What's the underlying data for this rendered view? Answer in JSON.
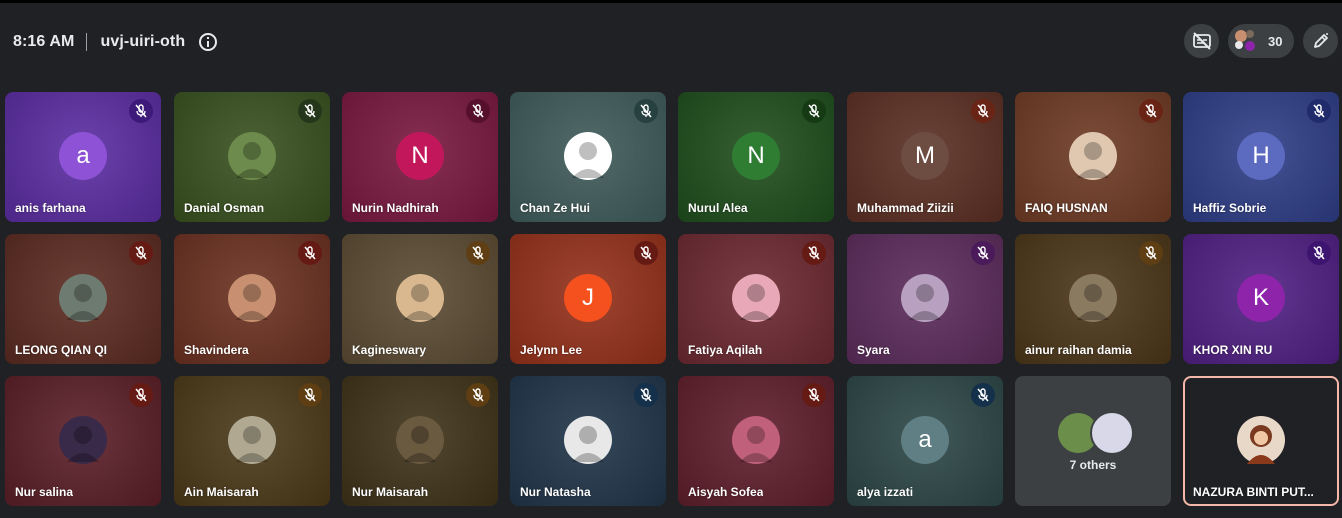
{
  "header": {
    "time": "8:16 AM",
    "meeting_code": "uvj-uiri-oth",
    "participant_count": "30",
    "info_icon": "info-icon",
    "captions_icon": "captions-off-icon",
    "edit_icon": "pen-icon"
  },
  "mic_icon": "mic-off-icon",
  "participants": [
    {
      "name": "anis farhana",
      "initial": "a",
      "bg": "#5a2ca0",
      "avatar_color": "#8d52d6",
      "mic_bg": "#3d1a7a"
    },
    {
      "name": "Danial Osman",
      "initial": "",
      "bg": "#38501e",
      "avatar_color": "#6d8b4c",
      "mic_bg": "#24371a"
    },
    {
      "name": "Nurin Nadhirah",
      "initial": "N",
      "bg": "#78183f",
      "avatar_color": "#c2185b",
      "mic_bg": "#56102c"
    },
    {
      "name": "Chan Ze Hui",
      "initial": "",
      "bg": "#3e5a59",
      "avatar_color": "#ffffff",
      "mic_bg": "#264140"
    },
    {
      "name": "Nurul Alea",
      "initial": "N",
      "bg": "#1f4d1c",
      "avatar_color": "#2e7d32",
      "mic_bg": "#163a14"
    },
    {
      "name": "Muhammad Ziizii",
      "initial": "M",
      "bg": "#5a2e22",
      "avatar_color": "#6d4c41",
      "mic_bg": "#6a2416"
    },
    {
      "name": "FAIQ HUSNAN",
      "initial": "",
      "bg": "#6d3a24",
      "avatar_color": "#e0c8b0",
      "mic_bg": "#6a2416"
    },
    {
      "name": "Haffiz Sobrie",
      "initial": "H",
      "bg": "#2e3d86",
      "avatar_color": "#5c6bc0",
      "mic_bg": "#1f2b6a"
    },
    {
      "name": "LEONG QIAN QI",
      "initial": "",
      "bg": "#5a2a20",
      "avatar_color": "#6e7b70",
      "mic_bg": "#661a14"
    },
    {
      "name": "Shavindera",
      "initial": "",
      "bg": "#6a3020",
      "avatar_color": "#c89070",
      "mic_bg": "#661a14"
    },
    {
      "name": "Kagineswary",
      "initial": "",
      "bg": "#5a4a32",
      "avatar_color": "#d9b890",
      "mic_bg": "#5e3e12"
    },
    {
      "name": "Jelynn Lee",
      "initial": "J",
      "bg": "#93301a",
      "avatar_color": "#f4511e",
      "mic_bg": "#661a14"
    },
    {
      "name": "Fatiya Aqilah",
      "initial": "",
      "bg": "#6b2830",
      "avatar_color": "#e9a8b8",
      "mic_bg": "#661a14"
    },
    {
      "name": "Syara",
      "initial": "",
      "bg": "#5a2b5a",
      "avatar_color": "#b8a0c0",
      "mic_bg": "#4a1a5a"
    },
    {
      "name": "ainur raihan damia",
      "initial": "",
      "bg": "#4a3518",
      "avatar_color": "#8a7a60",
      "mic_bg": "#5e3e12"
    },
    {
      "name": "KHOR XIN RU",
      "initial": "K",
      "bg": "#4f1f82",
      "avatar_color": "#8e24aa",
      "mic_bg": "#3d1470"
    },
    {
      "name": "Nur salina",
      "initial": "",
      "bg": "#5a1e26",
      "avatar_color": "#3a2a4a",
      "mic_bg": "#661a14"
    },
    {
      "name": "Ain Maisarah",
      "initial": "",
      "bg": "#4a3818",
      "avatar_color": "#b0a890",
      "mic_bg": "#5e3e12"
    },
    {
      "name": "Nur Maisarah",
      "initial": "",
      "bg": "#3e3218",
      "avatar_color": "#6a5a40",
      "mic_bg": "#5e3e12"
    },
    {
      "name": "Nur Natasha",
      "initial": "",
      "bg": "#1f3448",
      "avatar_color": "#e8e8e8",
      "mic_bg": "#14304a"
    },
    {
      "name": "Aisyah Sofea",
      "initial": "",
      "bg": "#5e1e2a",
      "avatar_color": "#c0607a",
      "mic_bg": "#661a14"
    },
    {
      "name": "alya izzati",
      "initial": "a",
      "bg": "#2c4646",
      "avatar_color": "#5f7f84",
      "mic_bg": "#14304a"
    }
  ],
  "others": {
    "label": "7 others",
    "bg": "#3c4043"
  },
  "self": {
    "name": "NAZURA BINTI PUT...",
    "bg": "#6a3a2c",
    "avatar_color": "#e8d8c8",
    "border": "#f4b7a8"
  }
}
